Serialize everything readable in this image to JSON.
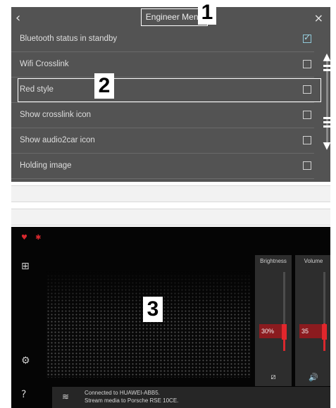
{
  "menu": {
    "back_icon": "‹",
    "close_icon": "×",
    "title": "Engineer Menu",
    "rows": [
      {
        "label": "Bluetooth status in standby",
        "checked": true
      },
      {
        "label": "Wifi Crosslink",
        "checked": false
      },
      {
        "label": "Red style",
        "checked": false
      },
      {
        "label": "Show crosslink icon",
        "checked": false
      },
      {
        "label": "Show audio2car icon",
        "checked": false
      },
      {
        "label": "Holding image",
        "checked": false
      }
    ],
    "check_glyph": "✓",
    "scroll_up_icon": "▲",
    "scroll_down_icon": "▼"
  },
  "callouts": [
    "1",
    "2",
    "3"
  ],
  "panel": {
    "status_icons": "♥ ✱",
    "brightness": {
      "title": "Brightness",
      "value_text": "30%",
      "level": 0.3,
      "icon": "⧄"
    },
    "volume": {
      "title": "Volume",
      "value_text": "35",
      "level": 0.35,
      "icon": "🔊"
    },
    "status_bar": {
      "line1": "Connected to HUAWEI-ABB5.",
      "line2": "Stream media to Porsche RSE 10CE."
    }
  },
  "colors": {
    "accent": "#d8282e",
    "menu_bg": "#535353",
    "panel_bg": "#050505"
  }
}
